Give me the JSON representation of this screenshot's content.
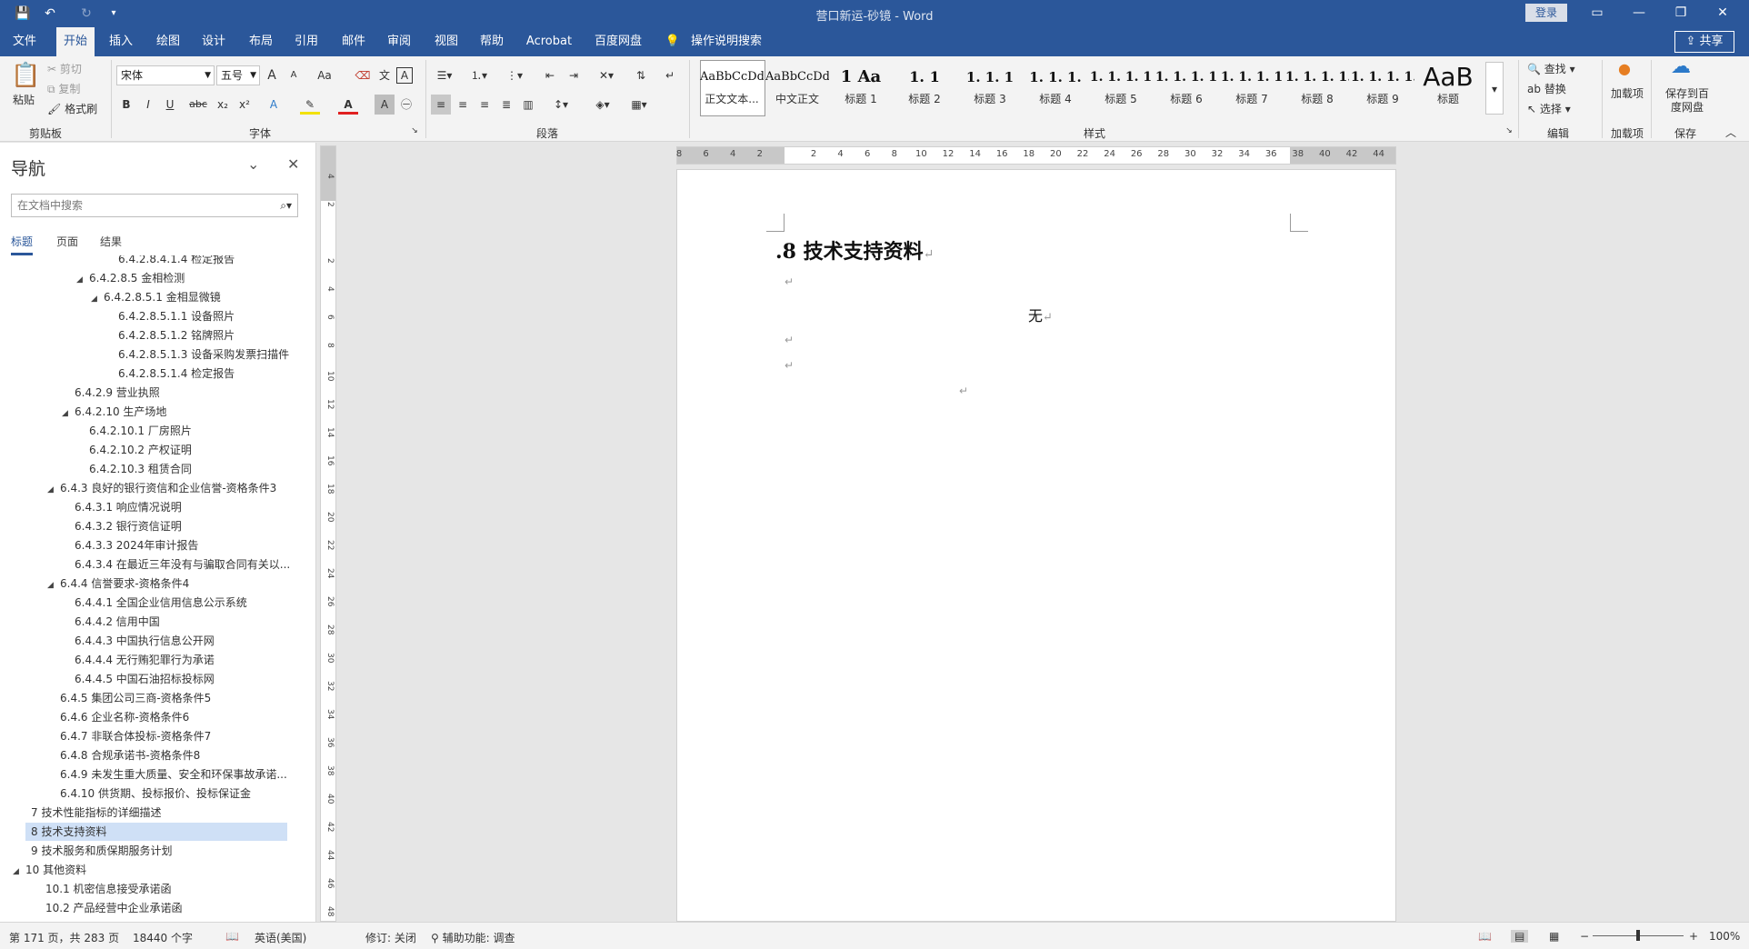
{
  "titlebar": {
    "doc_title": "营口新运-砂镜 - Word",
    "login": "登录",
    "save_glyph": "💾",
    "undo_glyph": "↶",
    "redo_glyph": "↻",
    "customize_glyph": "▾",
    "ribbon_display_glyph": "▭",
    "minimize_glyph": "—",
    "restore_glyph": "❐",
    "close_glyph": "✕"
  },
  "tabs": {
    "items": [
      "文件",
      "开始",
      "插入",
      "绘图",
      "设计",
      "布局",
      "引用",
      "邮件",
      "审阅",
      "视图",
      "帮助",
      "Acrobat",
      "百度网盘"
    ],
    "active": "开始",
    "tell_me": "操作说明搜索",
    "share": "共享"
  },
  "ribbon": {
    "clipboard": {
      "paste": "粘贴",
      "cut": "剪切",
      "copy": "复制",
      "format_painter": "格式刷",
      "label": "剪贴板"
    },
    "font": {
      "font_name": "宋体",
      "font_size": "五号",
      "grow": "A",
      "shrink": "A",
      "case": "Aa",
      "bold": "B",
      "italic": "I",
      "underline": "U",
      "strike": "abc",
      "sub": "x₂",
      "sup": "x²",
      "label": "字体"
    },
    "paragraph": {
      "label": "段落"
    },
    "styles": {
      "label": "样式",
      "items": [
        {
          "preview": "AaBbCcDdI",
          "name": "正文文本..."
        },
        {
          "preview": "AaBbCcDd",
          "name": "中文正文"
        },
        {
          "preview": "1 Aa",
          "name": "标题 1"
        },
        {
          "preview": "1. 1",
          "name": "标题 2"
        },
        {
          "preview": "1. 1. 1",
          "name": "标题 3"
        },
        {
          "preview": "1. 1. 1.",
          "name": "标题 4"
        },
        {
          "preview": "1. 1. 1. 1",
          "name": "标题 5"
        },
        {
          "preview": "1. 1. 1. 1",
          "name": "标题 6"
        },
        {
          "preview": "1. 1. 1. 1",
          "name": "标题 7"
        },
        {
          "preview": "1. 1. 1. 1.",
          "name": "标题 8"
        },
        {
          "preview": "1. 1. 1. 1.",
          "name": "标题 9"
        },
        {
          "preview": "AaB",
          "name": "标题"
        }
      ]
    },
    "editing": {
      "find": "查找",
      "replace": "替换",
      "select": "选择",
      "label": "编辑"
    },
    "addins": {
      "item": "加载项",
      "label": "加载项"
    },
    "save": {
      "item": "保存到百度网盘",
      "label": "保存"
    }
  },
  "nav": {
    "title": "导航",
    "search_placeholder": "在文档中搜索",
    "tabs": [
      "标题",
      "页面",
      "结果"
    ],
    "items": [
      {
        "text": "6.4.2.8.4.1.4 检定报告",
        "level": 6,
        "tri": ""
      },
      {
        "text": "6.4.2.8.5 金相检测",
        "level": 4,
        "tri": "◢"
      },
      {
        "text": "6.4.2.8.5.1 金相显微镜",
        "level": 5,
        "tri": "◢"
      },
      {
        "text": "6.4.2.8.5.1.1 设备照片",
        "level": 6,
        "tri": ""
      },
      {
        "text": "6.4.2.8.5.1.2 铭牌照片",
        "level": 6,
        "tri": ""
      },
      {
        "text": "6.4.2.8.5.1.3 设备采购发票扫描件",
        "level": 6,
        "tri": ""
      },
      {
        "text": "6.4.2.8.5.1.4 检定报告",
        "level": 6,
        "tri": ""
      },
      {
        "text": "6.4.2.9 营业执照",
        "level": 3,
        "tri": ""
      },
      {
        "text": "6.4.2.10 生产场地",
        "level": 3,
        "tri": "◢"
      },
      {
        "text": "6.4.2.10.1 厂房照片",
        "level": 4,
        "tri": ""
      },
      {
        "text": "6.4.2.10.2 产权证明",
        "level": 4,
        "tri": ""
      },
      {
        "text": "6.4.2.10.3 租赁合同",
        "level": 4,
        "tri": ""
      },
      {
        "text": "6.4.3 良好的银行资信和企业信誉-资格条件3",
        "level": 2,
        "tri": "◢"
      },
      {
        "text": "6.4.3.1 响应情况说明",
        "level": 3,
        "tri": ""
      },
      {
        "text": "6.4.3.2 银行资信证明",
        "level": 3,
        "tri": ""
      },
      {
        "text": "6.4.3.3 2024年审计报告",
        "level": 3,
        "tri": ""
      },
      {
        "text": "6.4.3.4 在最近三年没有与骗取合同有关以...",
        "level": 3,
        "tri": ""
      },
      {
        "text": "6.4.4 信誉要求-资格条件4",
        "level": 2,
        "tri": "◢"
      },
      {
        "text": "6.4.4.1 全国企业信用信息公示系统",
        "level": 3,
        "tri": ""
      },
      {
        "text": "6.4.4.2 信用中国",
        "level": 3,
        "tri": ""
      },
      {
        "text": "6.4.4.3 中国执行信息公开网",
        "level": 3,
        "tri": ""
      },
      {
        "text": "6.4.4.4 无行贿犯罪行为承诺",
        "level": 3,
        "tri": ""
      },
      {
        "text": "6.4.4.5 中国石油招标投标网",
        "level": 3,
        "tri": ""
      },
      {
        "text": "6.4.5 集团公司三商-资格条件5",
        "level": 2,
        "tri": ""
      },
      {
        "text": "6.4.6 企业名称-资格条件6",
        "level": 2,
        "tri": ""
      },
      {
        "text": "6.4.7 非联合体投标-资格条件7",
        "level": 2,
        "tri": ""
      },
      {
        "text": "6.4.8 合规承诺书-资格条件8",
        "level": 2,
        "tri": ""
      },
      {
        "text": "6.4.9 未发生重大质量、安全和环保事故承诺...",
        "level": 2,
        "tri": ""
      },
      {
        "text": "6.4.10 供货期、投标报价、投标保证金",
        "level": 2,
        "tri": ""
      },
      {
        "text": "7 技术性能指标的详细描述",
        "level": 0,
        "tri": ""
      },
      {
        "text": "8 技术支持资料",
        "level": 0,
        "tri": "",
        "selected": true
      },
      {
        "text": "9 技术服务和质保期服务计划",
        "level": 0,
        "tri": ""
      },
      {
        "text": "10 其他资料",
        "level": -1,
        "tri": "◢"
      },
      {
        "text": "10.1 机密信息接受承诺函",
        "level": 1,
        "tri": ""
      },
      {
        "text": "10.2 产品经营中企业承诺函",
        "level": 1,
        "tri": ""
      }
    ]
  },
  "ruler": {
    "h_ticks": [
      "8",
      "6",
      "4",
      "2",
      "",
      "2",
      "4",
      "6",
      "8",
      "10",
      "12",
      "14",
      "16",
      "18",
      "20",
      "22",
      "24",
      "26",
      "28",
      "30",
      "32",
      "34",
      "36",
      "38",
      "40",
      "42",
      "44"
    ],
    "v_ticks": [
      "4",
      "2",
      "",
      "2",
      "4",
      "6",
      "8",
      "10",
      "12",
      "14",
      "16",
      "18",
      "20",
      "22",
      "24",
      "26",
      "28",
      "30",
      "32",
      "34",
      "36",
      "38",
      "40",
      "42",
      "44",
      "46",
      "48"
    ]
  },
  "document": {
    "heading": ".8  技术支持资料",
    "body": "无",
    "para_mark": "↵"
  },
  "status": {
    "page": "第 171 页，共 283 页",
    "words": "18440 个字",
    "lang": "英语(美国)",
    "track": "修订: 关闭",
    "accessibility": "辅助功能: 调查",
    "zoom": "100%",
    "zoom_minus": "−",
    "zoom_plus": "+"
  },
  "colors": {
    "accent": "#2b579a",
    "selected_nav": "#cfe0f6"
  }
}
